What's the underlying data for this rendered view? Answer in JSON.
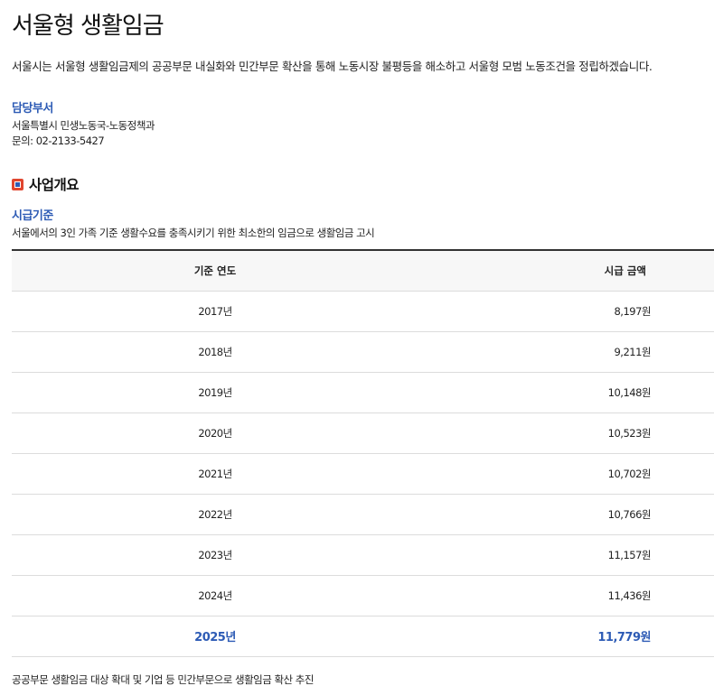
{
  "page": {
    "title": "서울형 생활임금",
    "intro": "서울시는 서울형 생활임금제의 공공부문 내실화와 민간부문 확산을 통해 노동시장 불평등을 해소하고 서울형 모범 노동조건을 정립하겠습니다."
  },
  "department": {
    "heading": "담당부서",
    "name": "서울특별시 민생노동국-노동정책과",
    "contact": "문의: 02-2133-5427"
  },
  "section": {
    "title": "사업개요",
    "sub_heading": "시급기준",
    "sub_desc": "서울에서의 3인 가족 기준 생활수요를 충족시키기 위한 최소한의 임금으로 생활임금 고시"
  },
  "table": {
    "headers": [
      "기준 연도",
      "시급 금액"
    ],
    "rows": [
      [
        "2017년",
        "8,197원"
      ],
      [
        "2018년",
        "9,211원"
      ],
      [
        "2019년",
        "10,148원"
      ],
      [
        "2020년",
        "10,523원"
      ],
      [
        "2021년",
        "10,702원"
      ],
      [
        "2022년",
        "10,766원"
      ],
      [
        "2023년",
        "11,157원"
      ],
      [
        "2024년",
        "11,436원"
      ],
      [
        "2025년",
        "11,779원"
      ]
    ],
    "highlight_row_index": 8,
    "highlight_color": "#2d5bb5"
  },
  "footer": {
    "text": "공공부문 생활임금 대상 확대 및 기업 등 민간부문으로 생활임금 확산 추진"
  },
  "colors": {
    "accent": "#2d5bb5",
    "icon_red": "#e0462f"
  }
}
